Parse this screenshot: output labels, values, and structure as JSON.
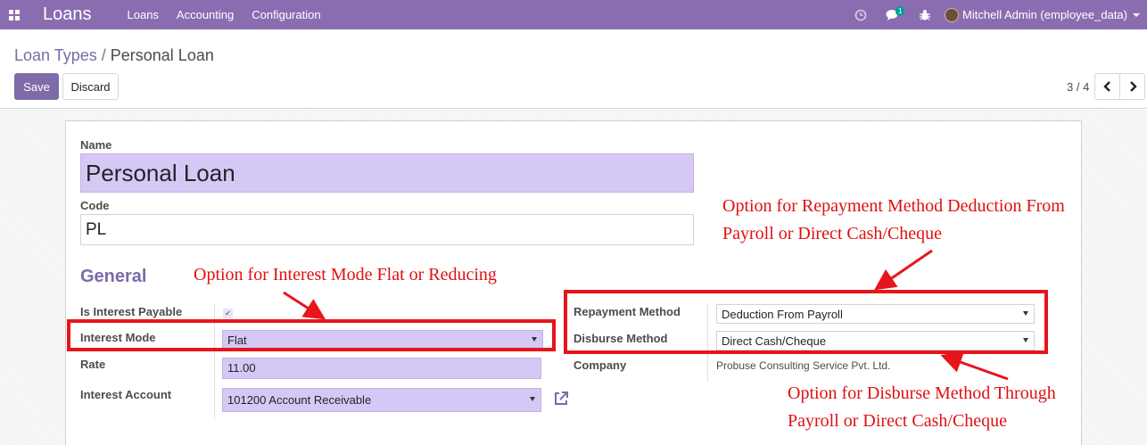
{
  "navbar": {
    "app_title": "Loans",
    "menu": [
      "Loans",
      "Accounting",
      "Configuration"
    ],
    "messages_count": "1",
    "user_name": "Mitchell Admin (employee_data)"
  },
  "breadcrumb": {
    "parent": "Loan Types",
    "separator": "/",
    "current": "Personal Loan"
  },
  "buttons": {
    "save": "Save",
    "discard": "Discard"
  },
  "pager": {
    "value": "3 / 4"
  },
  "form": {
    "name_label": "Name",
    "name_value": "Personal Loan",
    "code_label": "Code",
    "code_value": "PL",
    "group_title": "General",
    "is_interest_payable_label": "Is Interest Payable",
    "is_interest_payable": true,
    "interest_mode_label": "Interest Mode",
    "interest_mode_value": "Flat",
    "rate_label": "Rate",
    "rate_value": "11.00",
    "interest_account_label": "Interest Account",
    "interest_account_value": "101200 Account Receivable",
    "repayment_method_label": "Repayment Method",
    "repayment_method_value": "Deduction From Payroll",
    "disburse_method_label": "Disburse Method",
    "disburse_method_value": "Direct Cash/Cheque",
    "company_label": "Company",
    "company_value": "Probuse Consulting Service Pvt. Ltd."
  },
  "annotations": {
    "interest_mode_note": "Option for  Interest Mode Flat or Reducing",
    "repayment_note_line1": "Option for Repayment Method Deduction From",
    "repayment_note_line2": "Payroll or Direct Cash/Cheque",
    "disburse_note_line1": "Option for Disburse Method Through",
    "disburse_note_line2": "Payroll or Direct Cash/Cheque"
  },
  "colors": {
    "navbar": "#8a6db0",
    "primary": "#7e6ba9",
    "required_field": "#d6c8f5",
    "annotation": "#e8141c"
  }
}
